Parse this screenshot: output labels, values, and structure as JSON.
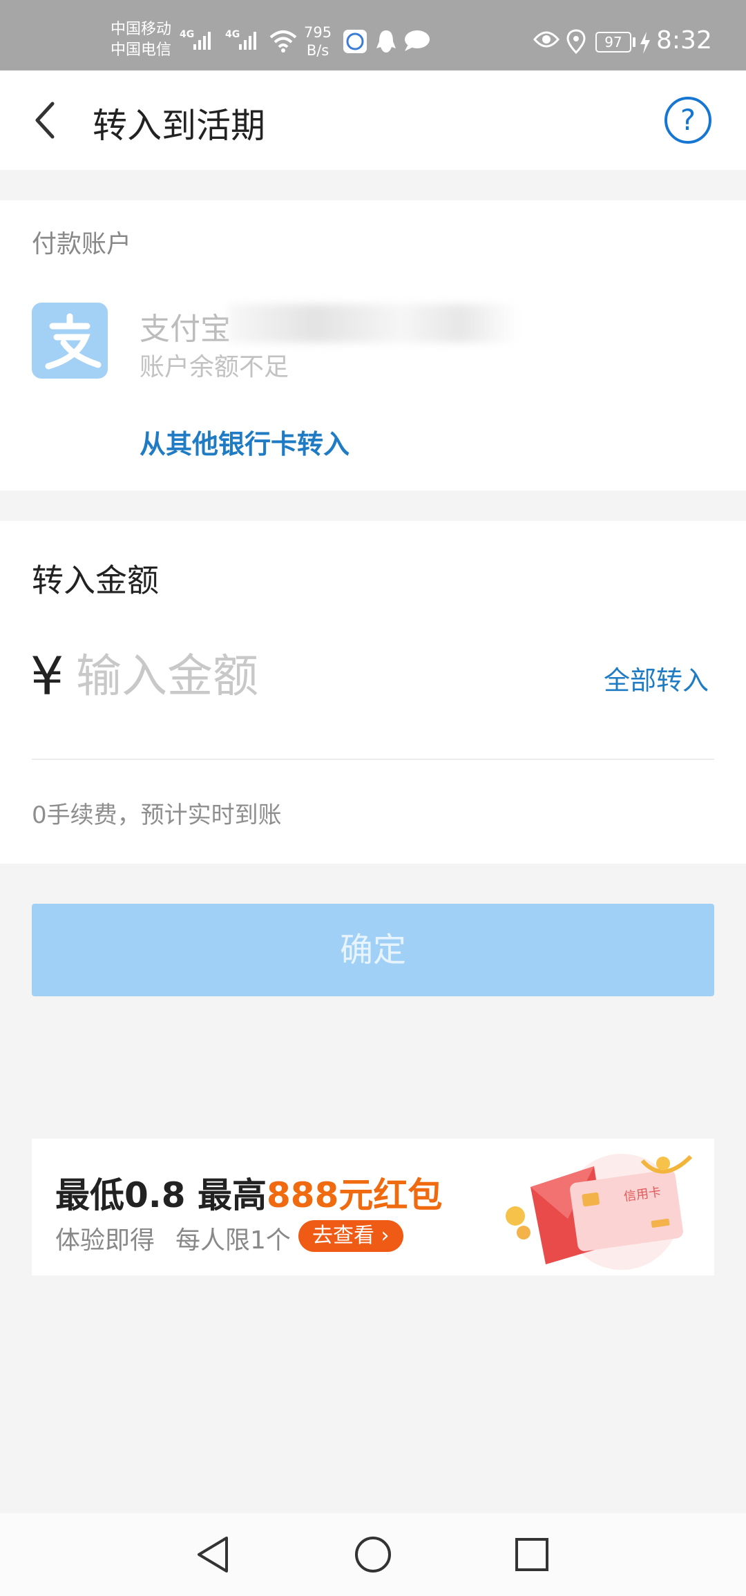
{
  "status_bar": {
    "carrier_1": "中国移动",
    "carrier_2": "中国电信",
    "net_1": "4G",
    "net_2": "4G",
    "speed_value": "795",
    "speed_unit": "B/s",
    "battery": "97",
    "time": "8:32"
  },
  "header": {
    "title": "转入到活期"
  },
  "payment": {
    "section_label": "付款账户",
    "account_name": "支付宝",
    "account_note": "账户余额不足",
    "other_bank_link": "从其他银行卡转入"
  },
  "amount": {
    "section_label": "转入金额",
    "currency_symbol": "¥",
    "placeholder": "输入金额",
    "all_in_label": "全部转入",
    "fee_note": "0手续费，预计实时到账"
  },
  "confirm": {
    "label": "确定"
  },
  "promo": {
    "title_part1": "最低0.8 最高",
    "title_highlight": "888元红包",
    "sub_1": "体验即得",
    "sub_2": "每人限1个",
    "cta": "去查看",
    "card_label": "信用卡"
  },
  "colors": {
    "accent": "#1f7cc4",
    "confirm_disabled": "#a1d0f6",
    "promo_highlight": "#f06a0f"
  }
}
